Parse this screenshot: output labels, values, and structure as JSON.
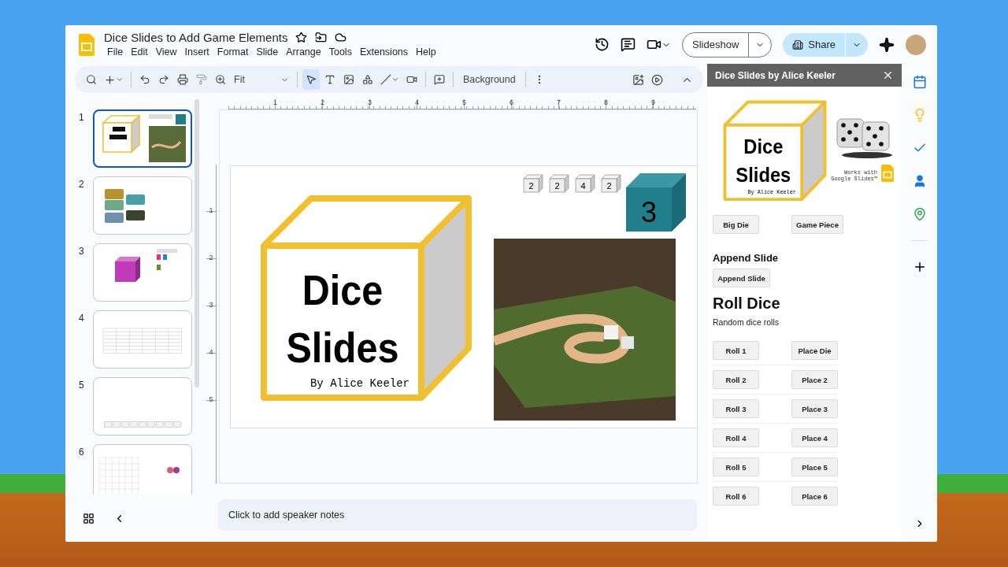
{
  "document": {
    "title": "Dice Slides to Add Game Elements"
  },
  "menu": [
    "File",
    "Edit",
    "View",
    "Insert",
    "Format",
    "Slide",
    "Arrange",
    "Tools",
    "Extensions",
    "Help"
  ],
  "header_buttons": {
    "slideshow": "Slideshow",
    "share": "Share"
  },
  "toolbar": {
    "zoom": "Fit",
    "background_button": "Background"
  },
  "filmstrip": {
    "slides": [
      {
        "number": "1",
        "selected": true,
        "kind": "title"
      },
      {
        "number": "2",
        "selected": false,
        "kind": "blocks"
      },
      {
        "number": "3",
        "selected": false,
        "kind": "die"
      },
      {
        "number": "4",
        "selected": false,
        "kind": "table"
      },
      {
        "number": "5",
        "selected": false,
        "kind": "track"
      },
      {
        "number": "6",
        "selected": false,
        "kind": "grid"
      }
    ]
  },
  "ruler": {
    "horizontal": [
      "1",
      "2",
      "3",
      "4",
      "5",
      "6",
      "7",
      "8",
      "9"
    ],
    "vertical": [
      "1",
      "2",
      "3",
      "4",
      "5"
    ]
  },
  "slide": {
    "title_lines": [
      "Dice",
      "Slides"
    ],
    "byline": "By Alice Keeler",
    "small_dice": [
      "2",
      "2",
      "4",
      "2"
    ],
    "big_die": "3"
  },
  "notes": {
    "placeholder": "Click to add speaker notes"
  },
  "sidebar": {
    "title": "Dice Slides by Alice Keeler",
    "logo": {
      "title_lines": [
        "Dice",
        "Slides"
      ],
      "byline": "By Alice Keeler",
      "tagline": "Works with Google Slides™"
    },
    "top_buttons": [
      "Big Die",
      "Game Piece"
    ],
    "append_heading": "Append Slide",
    "append_button": "Append Slide",
    "roll_heading": "Roll Dice",
    "roll_subtitle": "Random dice rolls",
    "rows": [
      [
        "Roll 1",
        "Place Die"
      ],
      [
        "Roll 2",
        "Place 2"
      ],
      [
        "Roll 3",
        "Place 3"
      ],
      [
        "Roll 4",
        "Place 4"
      ],
      [
        "Roll 5",
        "Place 5"
      ],
      [
        "Roll 6",
        "Place 6"
      ]
    ]
  }
}
